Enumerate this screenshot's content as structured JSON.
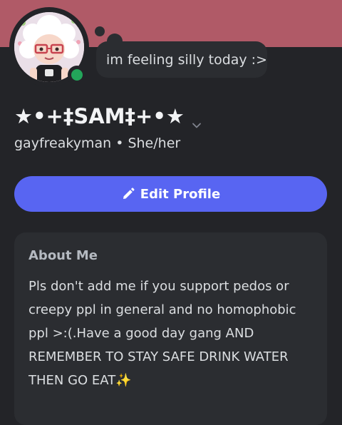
{
  "status": {
    "text": "im feeling silly today :>",
    "online": true
  },
  "profile": {
    "display_name": "★•+‡SAM‡+•★",
    "username": "gayfreakyman",
    "separator": "•",
    "pronouns": "She/her"
  },
  "actions": {
    "edit_profile_label": "Edit Profile"
  },
  "about": {
    "title": "About Me",
    "body": "Pls don't add me if you support pedos or\ncreepy ppl in general and no homophobic\nppl >:(.Have a good day gang AND\nREMEMBER TO STAY SAFE DRINK WATER\nTHEN GO EAT✨"
  },
  "colors": {
    "banner": "#b05a67",
    "background": "#232428",
    "card": "#2b2d31",
    "accent": "#5865f2",
    "online": "#23a55a"
  }
}
